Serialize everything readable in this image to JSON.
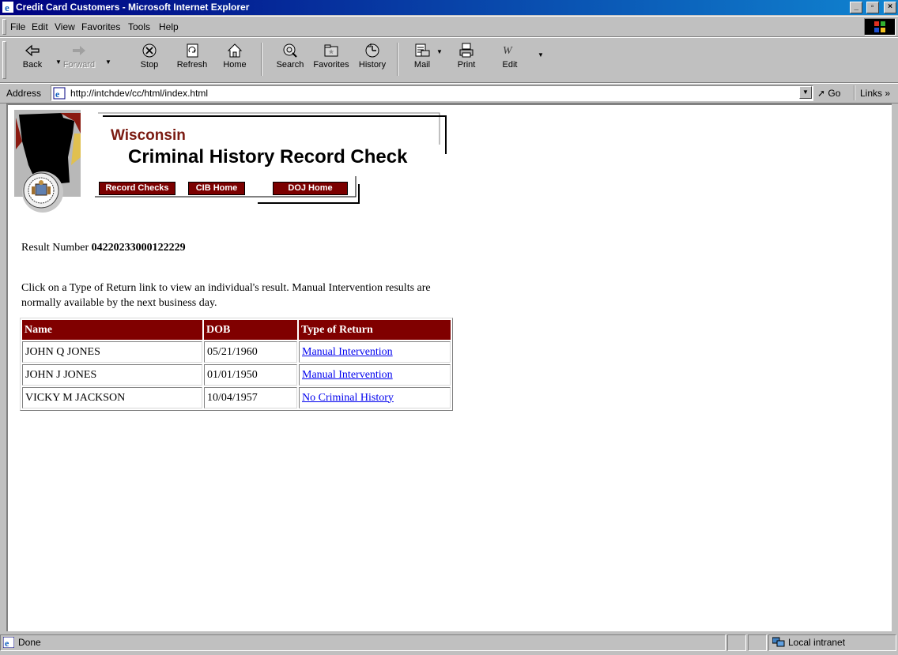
{
  "window": {
    "title": "Credit Card Customers - Microsoft Internet Explorer",
    "controls": {
      "minimize": "_",
      "maximize": "▫",
      "close": "×"
    }
  },
  "menu": {
    "items": [
      {
        "label": "File"
      },
      {
        "label": "Edit"
      },
      {
        "label": "View"
      },
      {
        "label": "Favorites"
      },
      {
        "label": "Tools"
      },
      {
        "label": "Help"
      }
    ]
  },
  "toolbar": {
    "buttons": [
      {
        "label": "Back",
        "icon": "back-arrow-icon"
      },
      {
        "label": "Forward",
        "icon": "forward-arrow-icon",
        "disabled": true
      },
      {
        "label": "Stop",
        "icon": "stop-icon"
      },
      {
        "label": "Refresh",
        "icon": "refresh-icon"
      },
      {
        "label": "Home",
        "icon": "home-icon"
      },
      {
        "label": "Search",
        "icon": "search-icon"
      },
      {
        "label": "Favorites",
        "icon": "favorites-icon"
      },
      {
        "label": "History",
        "icon": "history-icon"
      },
      {
        "label": "Mail",
        "icon": "mail-icon"
      },
      {
        "label": "Print",
        "icon": "print-icon"
      },
      {
        "label": "Edit",
        "icon": "edit-icon"
      }
    ]
  },
  "address": {
    "label": "Address",
    "url": "http://intchdev/cc/html/index.html",
    "go_label": "Go",
    "links_label": "Links »"
  },
  "page": {
    "banner": {
      "state": "Wisconsin",
      "title": "Criminal History Record Check",
      "nav": [
        {
          "label": "Record Checks"
        },
        {
          "label": "CIB Home"
        },
        {
          "label": "DOJ Home"
        }
      ]
    },
    "result_label": "Result Number",
    "result_number": "04220233000122229",
    "instructions": "Click on a Type of Return link to view an individual's result. Manual Intervention results are normally available by the next business day.",
    "table": {
      "headers": [
        "Name",
        "DOB",
        "Type of Return"
      ],
      "rows": [
        {
          "name": "JOHN Q JONES",
          "dob": "05/21/1960",
          "type": "Manual Intervention"
        },
        {
          "name": "JOHN J JONES",
          "dob": "01/01/1950",
          "type": "Manual Intervention"
        },
        {
          "name": "VICKY M JACKSON",
          "dob": "10/04/1957",
          "type": "No Criminal History"
        }
      ]
    }
  },
  "status": {
    "text": "Done",
    "zone": "Local intranet"
  },
  "colors": {
    "title_gradient_start": "#000080",
    "title_gradient_end": "#1084d0",
    "maroon": "#800000",
    "link": "#0000ee"
  }
}
